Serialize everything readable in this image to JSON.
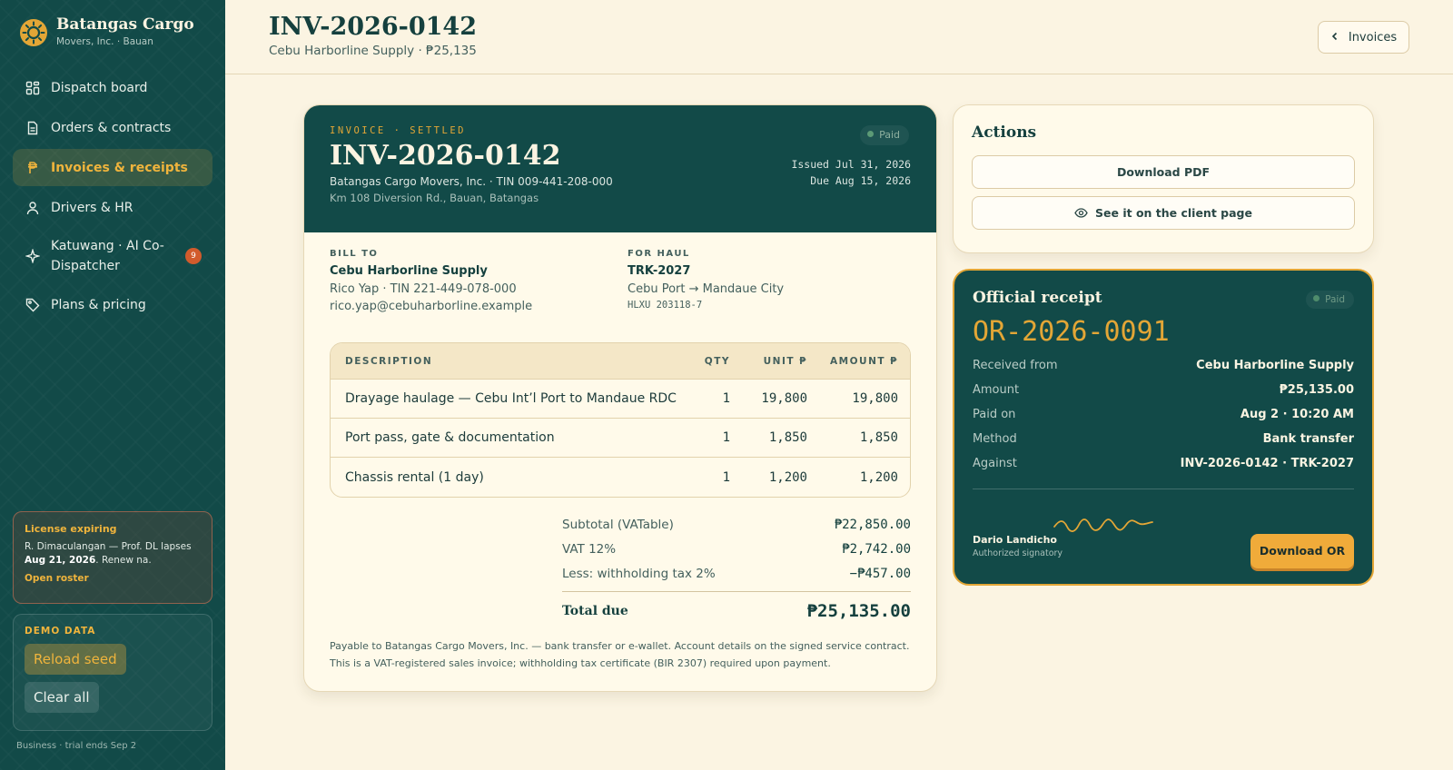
{
  "brand": {
    "name": "Batangas Cargo",
    "sub": "Movers, Inc. · Bauan"
  },
  "nav": [
    {
      "label": "Dispatch board",
      "icon": "grid-icon"
    },
    {
      "label": "Orders & contracts",
      "icon": "document-icon"
    },
    {
      "label": "Invoices & receipts",
      "icon": "peso-icon",
      "active": true
    },
    {
      "label": "Drivers & HR",
      "icon": "person-icon"
    },
    {
      "label": "Katuwang · AI Co-Dispatcher",
      "icon": "sparkle-icon",
      "badge": "9"
    },
    {
      "label": "Plans & pricing",
      "icon": "tag-icon"
    }
  ],
  "license": {
    "title": "License expiring",
    "body_prefix": "R. Dimaculangan — Prof. DL lapses ",
    "body_date": "Aug 21, 2026",
    "body_suffix": ". Renew na.",
    "link": "Open roster"
  },
  "demo": {
    "title": "DEMO DATA",
    "reload": "Reload seed",
    "clear": "Clear all"
  },
  "sidebar_footer": "Business · trial ends Sep 2",
  "header": {
    "title": "INV-2026-0142",
    "subtitle": "Cebu Harborline Supply · ₱25,135",
    "back_label": "Invoices"
  },
  "invoice": {
    "kicker": "INVOICE · SETTLED",
    "number": "INV-2026-0142",
    "status": "Paid",
    "company": "Batangas Cargo Movers, Inc. · TIN 009-441-208-000",
    "address": "Km 108 Diversion Rd., Bauan, Batangas",
    "issued": "Issued Jul 31, 2026",
    "due": "Due Aug 15, 2026",
    "bill_to": {
      "label": "BILL TO",
      "name": "Cebu Harborline Supply",
      "contact": "Rico Yap · TIN 221-449-078-000",
      "email": "rico.yap@cebuharborline.example"
    },
    "haul": {
      "label": "FOR HAUL",
      "truck": "TRK-2027",
      "route": "Cebu Port → Mandaue City",
      "container": "HLXU 203118-7"
    },
    "columns": {
      "desc": "DESCRIPTION",
      "qty": "QTY",
      "unit": "UNIT ₱",
      "amount": "AMOUNT ₱"
    },
    "lines": [
      {
        "desc": "Drayage haulage — Cebu Int’l Port to Mandaue RDC",
        "qty": "1",
        "unit": "19,800",
        "amount": "19,800"
      },
      {
        "desc": "Port pass, gate & documentation",
        "qty": "1",
        "unit": "1,850",
        "amount": "1,850"
      },
      {
        "desc": "Chassis rental (1 day)",
        "qty": "1",
        "unit": "1,200",
        "amount": "1,200"
      }
    ],
    "totals": {
      "subtotal_label": "Subtotal (VATable)",
      "subtotal": "₱22,850.00",
      "vat_label": "VAT 12%",
      "vat": "₱2,742.00",
      "wht_label": "Less: withholding tax 2%",
      "wht": "−₱457.00",
      "total_label": "Total due",
      "total": "₱25,135.00"
    },
    "note": "Payable to Batangas Cargo Movers, Inc. — bank transfer or e-wallet. Account details on the signed service contract. This is a VAT-registered sales invoice; withholding tax certificate (BIR 2307) required upon payment."
  },
  "actions": {
    "title": "Actions",
    "download_pdf": "Download PDF",
    "client_page": "See it on the client page"
  },
  "receipt": {
    "title": "Official receipt",
    "status": "Paid",
    "number": "OR-2026-0091",
    "rows": [
      {
        "k": "Received from",
        "v": "Cebu Harborline Supply"
      },
      {
        "k": "Amount",
        "v": "₱25,135.00"
      },
      {
        "k": "Paid on",
        "v": "Aug 2 · 10:20 AM"
      },
      {
        "k": "Method",
        "v": "Bank transfer"
      },
      {
        "k": "Against",
        "v": "INV-2026-0142 · TRK-2027"
      }
    ],
    "signer": "Dario Landicho",
    "signer_role": "Authorized signatory",
    "download": "Download OR"
  },
  "colors": {
    "teal": "#124a48",
    "amber": "#e3a636",
    "cream": "#fbf4e2",
    "badge": "#d25b2c"
  }
}
